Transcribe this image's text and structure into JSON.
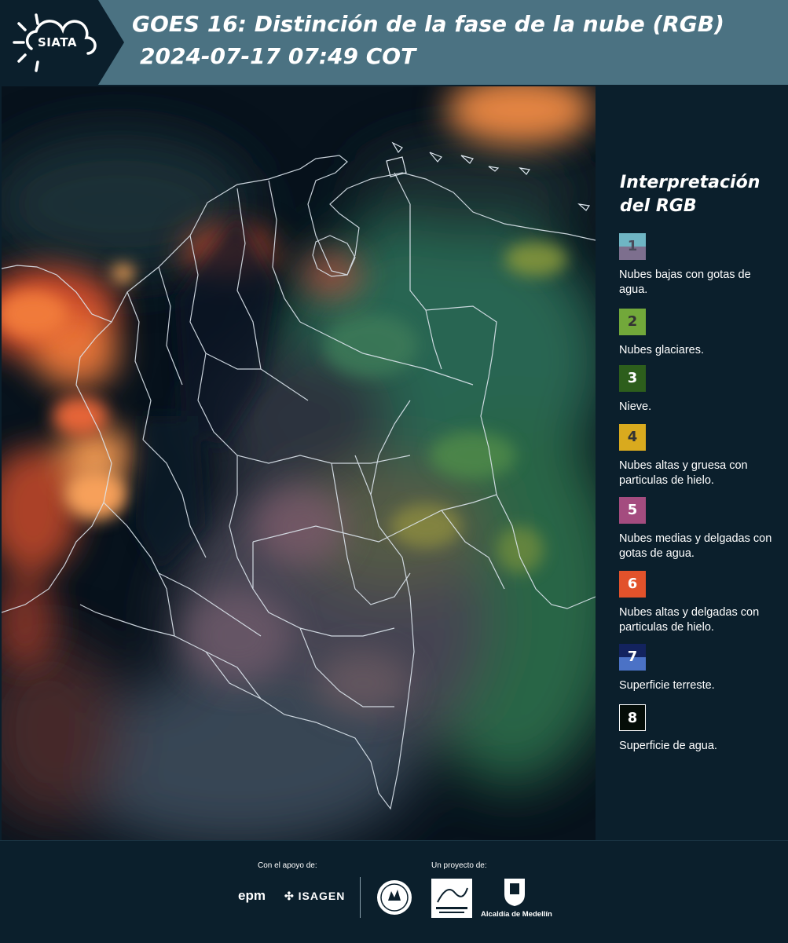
{
  "header": {
    "logo_text": "SIATA",
    "title_line1": "GOES 16: Distinción de la fase de la nube (RGB)",
    "title_line2": "2024-07-17 07:49 COT"
  },
  "legend": {
    "title": "Interpretación del RGB",
    "items": [
      {
        "number": "1",
        "description": "Nubes bajas con gotas de agua.",
        "color_top": "#6fb5c4",
        "color_bottom": "#7d6f8e",
        "number_color": "#4a4a5a"
      },
      {
        "number": "2",
        "description": "Nubes glaciares.",
        "color_top": "#72a83a",
        "color_bottom": "#72a83a",
        "number_color": "#333333"
      },
      {
        "number": "3",
        "description": "Nieve.",
        "color_top": "#2d5e1c",
        "color_bottom": "#2d5e1c",
        "number_color": "#ffffff"
      },
      {
        "number": "4",
        "description": "Nubes altas y gruesa con particulas de hielo.",
        "color_top": "#d9aa1e",
        "color_bottom": "#d9aa1e",
        "number_color": "#333333"
      },
      {
        "number": "5",
        "description": "Nubes medias y delgadas con gotas de agua.",
        "color_top": "#a44c7f",
        "color_bottom": "#a44c7f",
        "number_color": "#ffffff"
      },
      {
        "number": "6",
        "description": "Nubes altas y delgadas con particulas de hielo.",
        "color_top": "#e2522b",
        "color_bottom": "#e2522b",
        "number_color": "#ffffff"
      },
      {
        "number": "7",
        "description": "Superficie terreste.",
        "color_top": "#13235e",
        "color_bottom": "#4b72c6",
        "number_color": "#ffffff"
      },
      {
        "number": "8",
        "description": "Superficie de agua.",
        "color_top": "#050d08",
        "color_bottom": "#050d08",
        "number_color": "#ffffff"
      }
    ]
  },
  "footer": {
    "support_caption": "Con el apoyo de:",
    "project_caption": "Un proyecto de:",
    "epm": "epm",
    "isagen": "ISAGEN",
    "alcaldia": "Alcaldía de Medellín"
  },
  "colors": {
    "header_bg": "#4b7282",
    "logo_bg": "#0b1f2c",
    "page_bg": "#0b1f2c"
  }
}
